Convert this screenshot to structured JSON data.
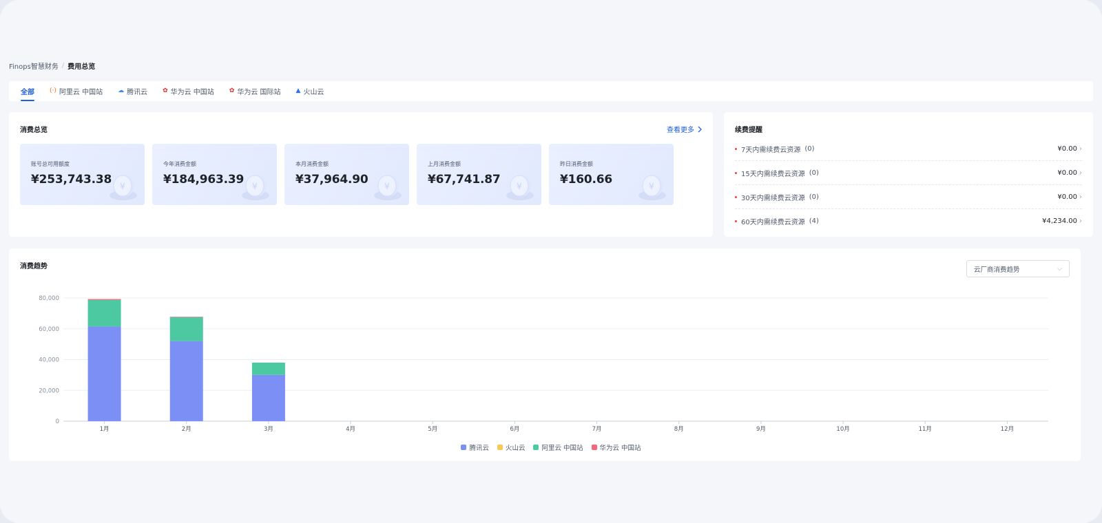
{
  "breadcrumb": {
    "parent": "Finops智慧财务",
    "separator": "/",
    "current": "费用总览"
  },
  "tabs": [
    {
      "label": "全部",
      "icon": "",
      "icon_color": ""
    },
    {
      "label": "阿里云 中国站",
      "icon": "(·)",
      "icon_color": "#ff6a00"
    },
    {
      "label": "腾讯云",
      "icon": "☁",
      "icon_color": "#3c8df0"
    },
    {
      "label": "华为云 中国站",
      "icon": "✿",
      "icon_color": "#e02b2b"
    },
    {
      "label": "华为云 国际站",
      "icon": "✿",
      "icon_color": "#e02b2b"
    },
    {
      "label": "火山云",
      "icon": "▲",
      "icon_color": "#2f6bff"
    }
  ],
  "overview": {
    "title": "消费总览",
    "more": "查看更多",
    "stats": [
      {
        "label": "账号总可用额度",
        "value": "¥253,743.38"
      },
      {
        "label": "今年消费金额",
        "value": "¥184,963.39"
      },
      {
        "label": "本月消费金额",
        "value": "¥37,964.90"
      },
      {
        "label": "上月消费金额",
        "value": "¥67,741.87"
      },
      {
        "label": "昨日消费金额",
        "value": "¥160.66"
      }
    ]
  },
  "renewal": {
    "title": "续费提醒",
    "items": [
      {
        "label": "7天内需续费云资源",
        "count": "(0)",
        "amount": "¥0.00"
      },
      {
        "label": "15天内需续费云资源",
        "count": "(0)",
        "amount": "¥0.00"
      },
      {
        "label": "30天内需续费云资源",
        "count": "(0)",
        "amount": "¥0.00"
      },
      {
        "label": "60天内需续费云资源",
        "count": "(4)",
        "amount": "¥4,234.00"
      }
    ]
  },
  "trend": {
    "title": "消费趋势",
    "select_value": "云厂商消费趋势"
  },
  "colors": {
    "accent": "#1e5fd6"
  },
  "chart_data": {
    "type": "bar",
    "stacked": true,
    "categories": [
      "1月",
      "2月",
      "3月",
      "4月",
      "5月",
      "6月",
      "7月",
      "8月",
      "9月",
      "10月",
      "11月",
      "12月"
    ],
    "series": [
      {
        "name": "腾讯云",
        "color": "#7b8ff5",
        "values": [
          61500,
          52000,
          30000,
          0,
          0,
          0,
          0,
          0,
          0,
          0,
          0,
          0
        ]
      },
      {
        "name": "火山云",
        "color": "#fac858",
        "values": [
          0,
          0,
          0,
          0,
          0,
          0,
          0,
          0,
          0,
          0,
          0,
          0
        ]
      },
      {
        "name": "阿里云 中国站",
        "color": "#4cc9a0",
        "values": [
          17200,
          15500,
          8000,
          0,
          0,
          0,
          0,
          0,
          0,
          0,
          0,
          0
        ]
      },
      {
        "name": "华为云 中国站",
        "color": "#f1697b",
        "values": [
          600,
          300,
          0,
          0,
          0,
          0,
          0,
          0,
          0,
          0,
          0,
          0
        ]
      }
    ],
    "ylim": [
      0,
      80000
    ],
    "yticks": [
      0,
      20000,
      40000,
      60000,
      80000
    ],
    "ytick_labels": [
      "0",
      "20,000",
      "40,000",
      "60,000",
      "80,000"
    ],
    "grid": true,
    "legend": "bottom-center"
  }
}
